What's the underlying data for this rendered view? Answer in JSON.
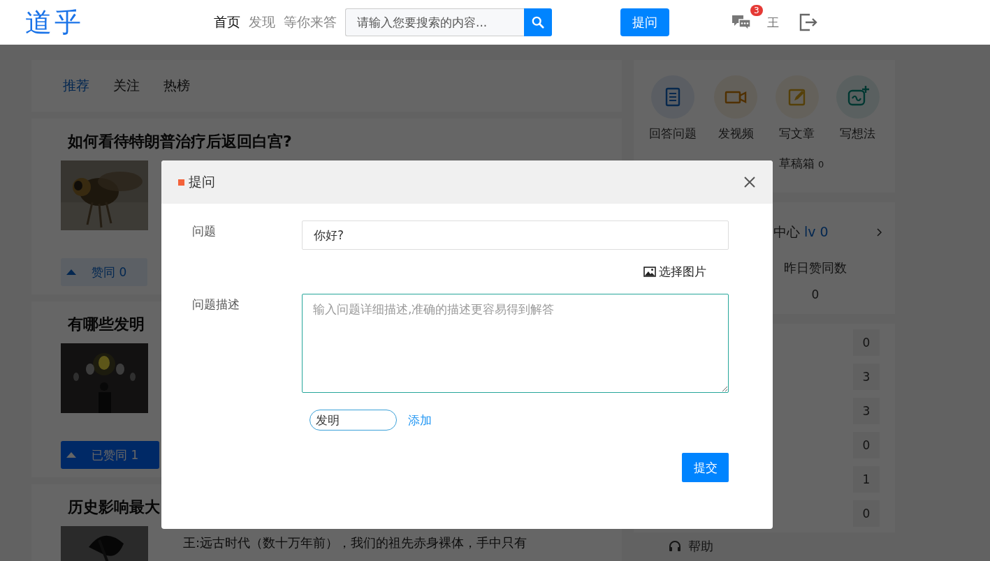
{
  "header": {
    "logo": "道乎",
    "nav": [
      {
        "label": "首页",
        "selected": true
      },
      {
        "label": "发现",
        "selected": false
      },
      {
        "label": "等你来答",
        "selected": false
      }
    ],
    "search": {
      "placeholder": "请输入您要搜索的内容..."
    },
    "ask_button": "提问",
    "message_badge": "3",
    "user": "王"
  },
  "feed_tabs": [
    {
      "label": "推荐",
      "selected": true
    },
    {
      "label": "关注",
      "selected": false
    },
    {
      "label": "热榜",
      "selected": false
    }
  ],
  "questions": [
    {
      "title": "如何看待特朗普治疗后返回白宫?",
      "vote": {
        "label": "赞同 0",
        "selected": false
      }
    },
    {
      "title": "有哪些发明",
      "vote": {
        "label": "已赞同 1",
        "selected": true
      }
    },
    {
      "title": "历史影响最大",
      "excerpt": "王:远古时代（数十万年前），我们的祖先赤身裸体，手中只有"
    }
  ],
  "actions": [
    {
      "label": "回答问题"
    },
    {
      "label": "发视频"
    },
    {
      "label": "写文章"
    },
    {
      "label": "写想法"
    }
  ],
  "drafts": {
    "label": "草稿箱",
    "count": "0"
  },
  "creator": {
    "label": "中心",
    "level": "lv 0",
    "stat_label": "昨日赞同数",
    "stat_value": "0"
  },
  "counts": [
    "0",
    "3",
    "3",
    "0",
    "1",
    "0"
  ],
  "help": "帮助",
  "modal": {
    "title": "提问",
    "question_label": "问题",
    "question_value": "你好?",
    "image_link": "选择图片",
    "description_label": "问题描述",
    "description_placeholder": "输入问题详细描述,准确的描述更容易得到解答",
    "tag_value": "发明",
    "add_link": "添加",
    "submit": "提交"
  }
}
